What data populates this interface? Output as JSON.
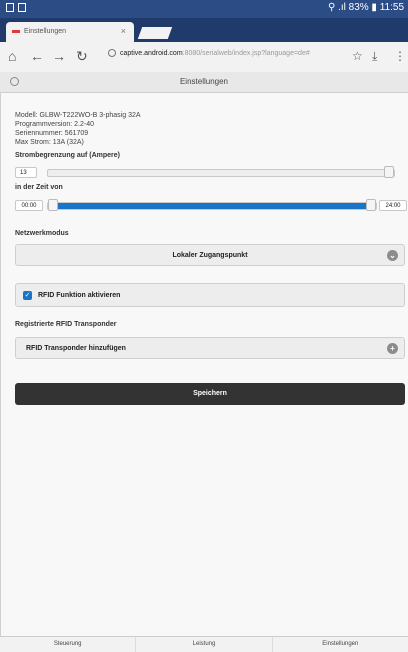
{
  "statusbar": {
    "right": "⚲ .ıl 83% ▮ 11:55"
  },
  "tab": {
    "title": "Einstellungen",
    "close": "×"
  },
  "toolbar": {
    "url_host": "captive.android.com",
    "url_rest": ":8080/serialweb/index.jsp?language=de#"
  },
  "header": {
    "title": "Einstellungen"
  },
  "info": {
    "model": "Modell: GLBW-T222WO-B 3-phasig 32A",
    "program": "Programmversion: 2.2-40",
    "serial": "Seriennummer: 561709",
    "max_current": "Max Strom: 13A (32A)"
  },
  "current_limit": {
    "label": "Strombegrenzung auf (Ampere)",
    "value": "13",
    "slider_fraction": 1.0
  },
  "time": {
    "label": "in der Zeit von",
    "start": "00:00",
    "end": "24:00",
    "range_start_fraction": 0.0,
    "range_end_fraction": 1.0
  },
  "network": {
    "label": "Netzwerkmodus",
    "selected": "Lokaler Zugangspunkt"
  },
  "rfid": {
    "checkbox_label": "RFID Funktion aktivieren",
    "checked": true,
    "registered_label": "Registrierte RFID Transponder",
    "add_label": "RFID Transponder hinzufügen"
  },
  "save_label": "Speichern",
  "bottom_nav": [
    "Steuerung",
    "Leistung",
    "Einstellungen"
  ],
  "colors": {
    "accent": "#1a74c8",
    "statusbar": "#2c4c86",
    "save": "#333333"
  }
}
